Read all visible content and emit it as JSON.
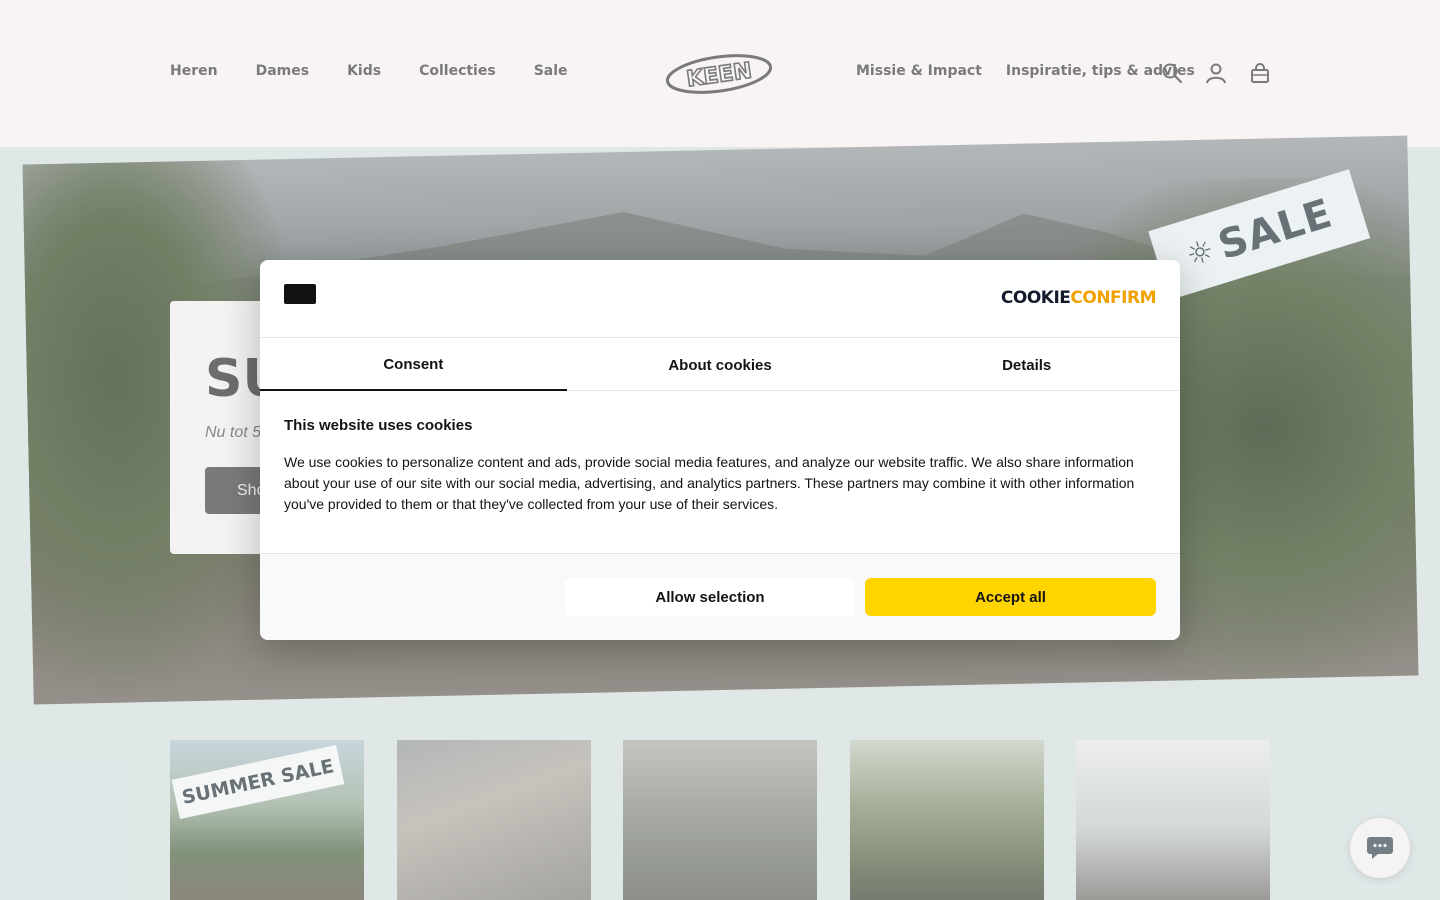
{
  "header": {
    "nav_left": [
      "Heren",
      "Dames",
      "Kids",
      "Collecties",
      "Sale"
    ],
    "nav_right": [
      "Missie & Impact",
      "Inspiratie, tips & advies"
    ],
    "logo_text": "KEEN",
    "icons": [
      "search-icon",
      "account-icon",
      "cart-icon"
    ]
  },
  "hero": {
    "title": "SU",
    "subtitle": "Nu tot 5",
    "button_label": "Sho",
    "sale_tag": "SALE"
  },
  "thumbnails": {
    "first_tag": "SUMMER SALE"
  },
  "cookie_dialog": {
    "brand_part1": "COOKIE",
    "brand_part2": "CONFIRM",
    "tabs": [
      "Consent",
      "About cookies",
      "Details"
    ],
    "active_tab": "Consent",
    "title": "This website uses cookies",
    "body": "We use cookies to personalize content and ads, provide social media features, and analyze our website traffic. We also share information about your use of our site with our social media, advertising, and analytics partners. These partners may combine it with other information you've provided to them or that they've collected from your use of their services.",
    "allow_selection": "Allow selection",
    "accept_all": "Accept all"
  },
  "colors": {
    "accent": "#ffd400",
    "header_bg": "#f6f1f0",
    "page_bg": "#d6e1e1"
  }
}
